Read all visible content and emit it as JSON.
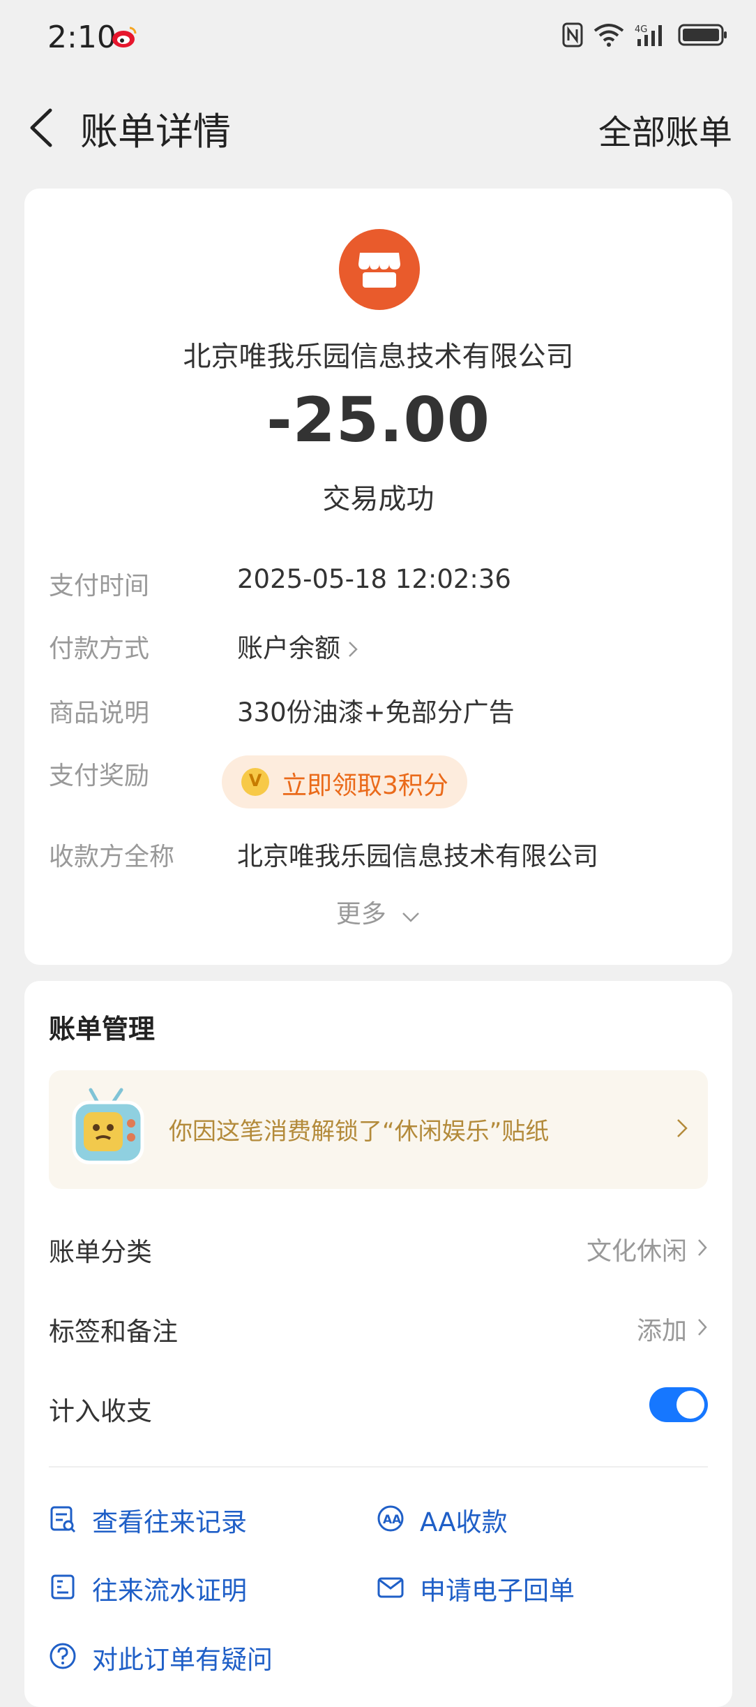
{
  "status_bar": {
    "time": "2:10"
  },
  "nav": {
    "title": "账单详情",
    "all_bills": "全部账单"
  },
  "bill": {
    "merchant": "北京唯我乐园信息技术有限公司",
    "amount": "-25.00",
    "status": "交易成功",
    "rows": [
      {
        "label": "支付时间",
        "value": "2025-05-18 12:02:36"
      },
      {
        "label": "付款方式",
        "value": "账户余额"
      },
      {
        "label": "商品说明",
        "value": "330份油漆+免部分广告"
      },
      {
        "label": "支付奖励",
        "value": "立即领取3积分"
      },
      {
        "label": "收款方全称",
        "value": "北京唯我乐园信息技术有限公司"
      }
    ],
    "more": "更多"
  },
  "management": {
    "title": "账单管理",
    "sticker_text": "你因这笔消费解锁了“休闲娱乐”贴纸",
    "category_label": "账单分类",
    "category_value": "文化休闲",
    "tags_label": "标签和备注",
    "tags_value": "添加",
    "include_label": "计入收支",
    "include_on": true,
    "actions": {
      "history": "查看往来记录",
      "aa": "AA收款",
      "statement": "往来流水证明",
      "receipt": "申请电子回单",
      "question": "对此订单有疑问"
    }
  },
  "colors": {
    "accent": "#1677ff",
    "brand_orange": "#e95b2c",
    "link": "#1f5fc7",
    "sticker_text": "#b38a3a"
  }
}
